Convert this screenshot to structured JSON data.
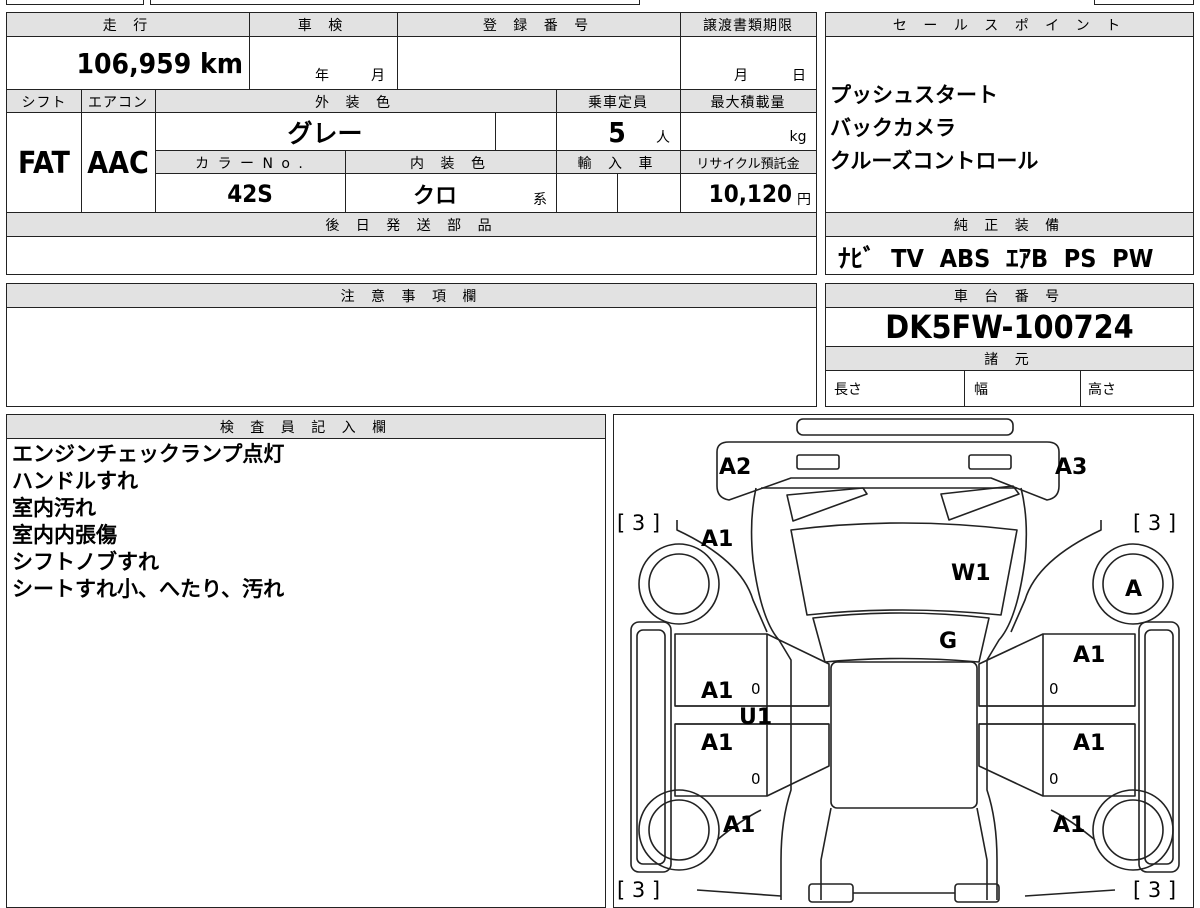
{
  "main": {
    "h_mileage": "走 行",
    "h_inspection": "車 検",
    "h_reg": "登 録 番 号",
    "h_transfer": "譲渡書類期限",
    "mileage": "106,959",
    "mileage_unit": "km",
    "year": "年",
    "month": "月",
    "t_month": "月",
    "t_day": "日",
    "h_shift": "シフト",
    "h_ac": "エアコン",
    "h_ext": "外 装 色",
    "h_cap": "乗車定員",
    "h_load": "最大積載量",
    "shift": "FAT",
    "ac": "AAC",
    "ext_color": "グレー",
    "capacity": "5",
    "cap_unit": "人",
    "load_unit": "kg",
    "h_colorno": "カ ラ ー N o .",
    "h_int": "内 装 色",
    "h_import": "輸 入 車",
    "h_recycle": "リサイクル預託金",
    "color_no": "42S",
    "int_color": "クロ",
    "int_suffix": "系",
    "recycle": "10,120",
    "recycle_unit": "円",
    "h_later": "後 日 発 送 部 品"
  },
  "sales": {
    "header": "セ ー ル ス ポ イ ン ト",
    "points": [
      "プッシュスタート",
      "バックカメラ",
      "クルーズコントロール"
    ]
  },
  "equipment": {
    "header": "純 正 装 備",
    "items": [
      "ﾅﾋﾞ",
      "TV",
      "ABS",
      "ｴｱB",
      "PS",
      "PW"
    ]
  },
  "notes": {
    "header": "注 意 事 項 欄"
  },
  "chassis": {
    "header": "車 台 番 号",
    "number": "DK5FW-100724",
    "spec_header": "諸 元",
    "length": "長さ",
    "width": "幅",
    "height": "高さ"
  },
  "inspector": {
    "header": "検 査 員 記 入 欄",
    "lines": [
      "エンジンチェックランプ点灯",
      "ハンドルすれ",
      "室内汚れ",
      "室内内張傷",
      "シフトノブすれ",
      "シートすれ小、へたり、汚れ"
    ]
  },
  "diagram": {
    "labels": [
      "A2",
      "A3",
      "[ 3 ]",
      "[ 3 ]",
      "A1",
      "W1",
      "A",
      "G",
      "A1",
      "A1",
      "0",
      "U1",
      "0",
      "A1",
      "A1",
      "0",
      "0",
      "A1",
      "A1",
      "[ 3 ]",
      "[ 3 ]"
    ]
  }
}
